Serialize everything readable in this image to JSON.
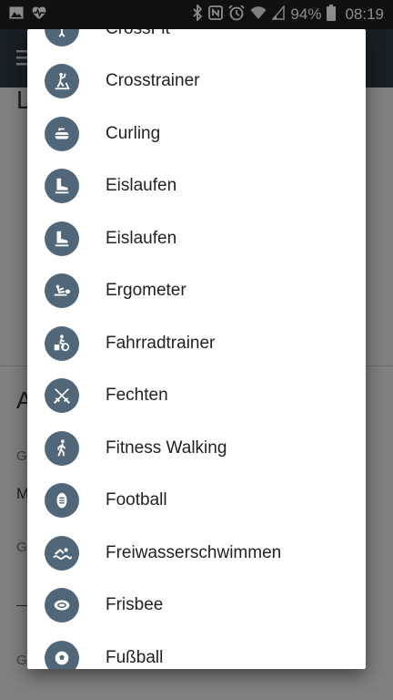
{
  "status_bar": {
    "battery": "94%",
    "time": "08:19",
    "icons": [
      "image-icon",
      "heart-monitor-icon",
      "bluetooth-icon",
      "nfc-icon",
      "alarm-icon",
      "wifi-icon",
      "signal-icon",
      "battery-icon"
    ]
  },
  "background": {
    "menu_icon": "hamburger-menu-icon",
    "letters": [
      "L",
      "A",
      "G",
      "M",
      "G",
      "G"
    ]
  },
  "dialog": {
    "items": [
      {
        "label": "CrossFit",
        "icon": "weightlifting-icon"
      },
      {
        "label": "Crosstrainer",
        "icon": "crosstrainer-icon"
      },
      {
        "label": "Curling",
        "icon": "curling-stone-icon"
      },
      {
        "label": "Eislaufen",
        "icon": "ice-skate-icon"
      },
      {
        "label": "Eislaufen",
        "icon": "ice-skate-icon"
      },
      {
        "label": "Ergometer",
        "icon": "rowing-machine-icon"
      },
      {
        "label": "Fahrradtrainer",
        "icon": "stationary-bike-icon"
      },
      {
        "label": "Fechten",
        "icon": "fencing-icon"
      },
      {
        "label": "Fitness Walking",
        "icon": "walking-icon"
      },
      {
        "label": "Football",
        "icon": "american-football-icon"
      },
      {
        "label": "Freiwasserschwimmen",
        "icon": "swimming-icon"
      },
      {
        "label": "Frisbee",
        "icon": "frisbee-icon"
      },
      {
        "label": "Fußball",
        "icon": "soccer-ball-icon"
      }
    ],
    "icon_color": "#50677a"
  }
}
